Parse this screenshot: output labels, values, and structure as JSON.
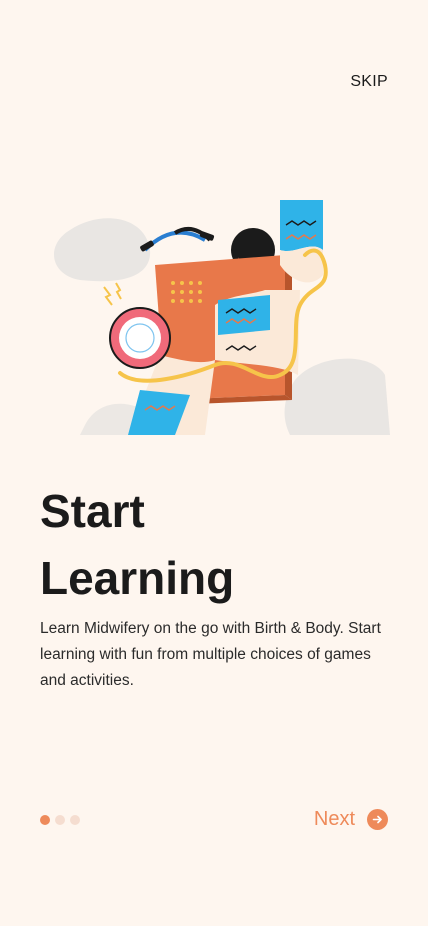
{
  "header": {
    "skip_label": "SKIP"
  },
  "main": {
    "title_line1": "Start",
    "title_line2": "Learning",
    "description": "Learn Midwifery on the go with Birth & Body. Start learning with fun from multiple choices of games and activities."
  },
  "pagination": {
    "total": 3,
    "active_index": 0
  },
  "footer": {
    "next_label": "Next",
    "next_icon": "arrow-right-icon"
  },
  "colors": {
    "accent": "#ee8a5a",
    "background": "#fef6ef",
    "dot_inactive": "#f5ddd0"
  }
}
